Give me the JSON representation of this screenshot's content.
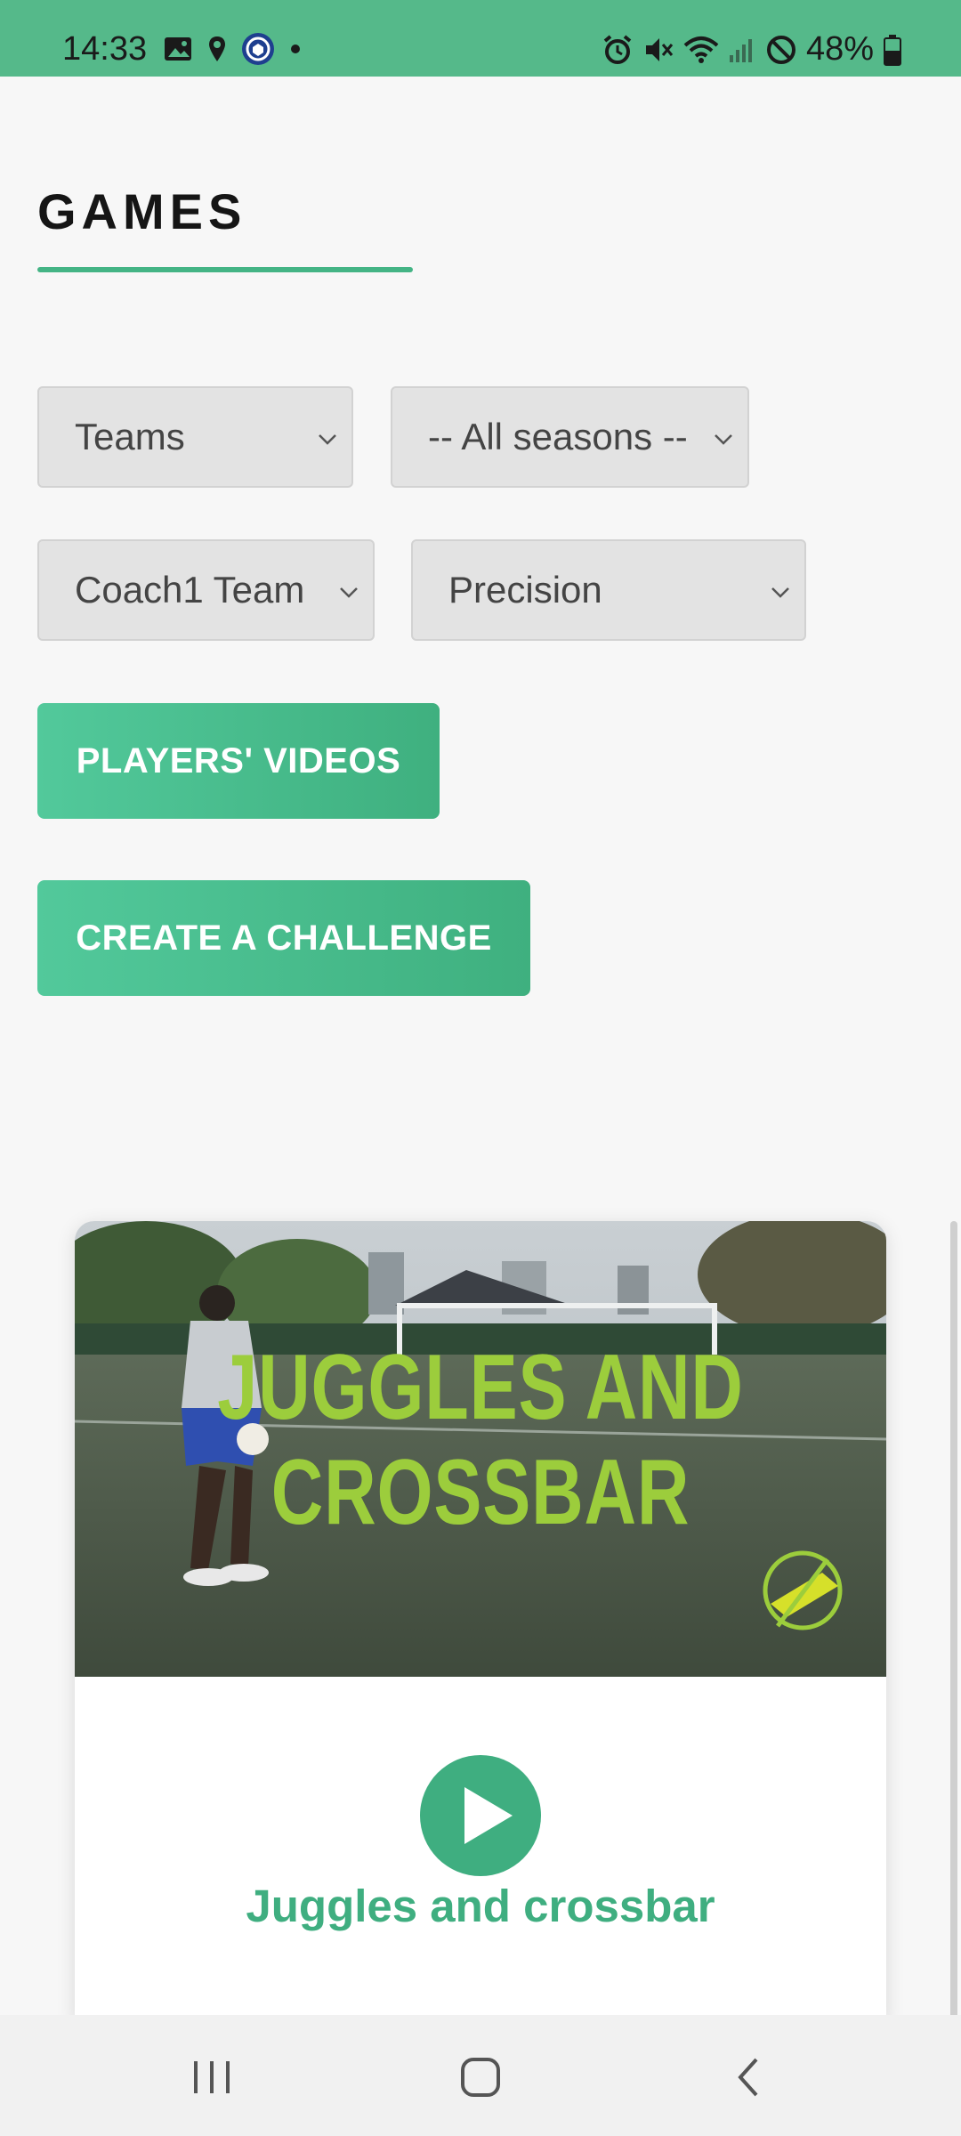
{
  "status_bar": {
    "time": "14:33",
    "battery": "48%",
    "left_icons": [
      "image-icon",
      "location-pin-icon",
      "shield-app-icon",
      "dot-icon"
    ],
    "right_icons": [
      "alarm-icon",
      "mute-icon",
      "wifi-icon",
      "signal-icon",
      "do-not-disturb-icon",
      "battery-icon"
    ]
  },
  "page": {
    "title": "GAMES"
  },
  "filters": {
    "teams": "Teams",
    "seasons": "-- All seasons --",
    "team": "Coach1 Team",
    "category": "Precision"
  },
  "buttons": {
    "players_videos": "PLAYERS' VIDEOS",
    "create_challenge": "CREATE A CHALLENGE"
  },
  "card": {
    "thumbnail_text_line1": "JUGGLES AND",
    "thumbnail_text_line2": "CROSSBAR",
    "title": "Juggles and crossbar"
  },
  "colors": {
    "accent": "#44b485",
    "status_bar": "#55b98a",
    "button_start": "#52c99b",
    "button_end": "#3fb07f",
    "thumbnail_text": "#9ccd3c"
  },
  "nav": {
    "icons": [
      "recents-icon",
      "home-icon",
      "back-icon"
    ]
  }
}
